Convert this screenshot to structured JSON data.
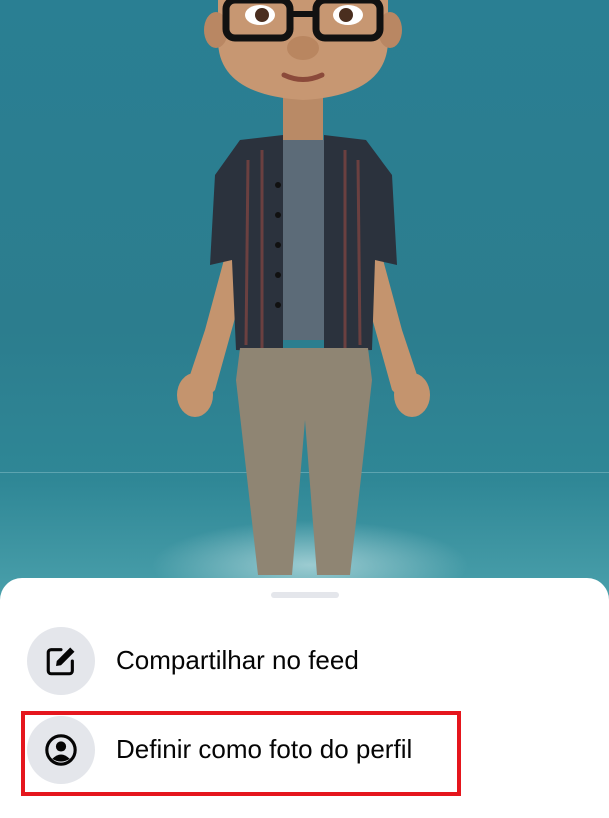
{
  "scene": {
    "avatar_description_name": "avatar-3d"
  },
  "menu": {
    "items": [
      {
        "label": "Compartilhar no feed",
        "icon": "edit-icon"
      },
      {
        "label": "Definir como foto do perfil",
        "icon": "profile-circle-icon"
      }
    ]
  },
  "colors": {
    "highlight": "#e5161d",
    "icon_bg": "#e4e6eb",
    "scene_bg": "#2c7d8e"
  }
}
